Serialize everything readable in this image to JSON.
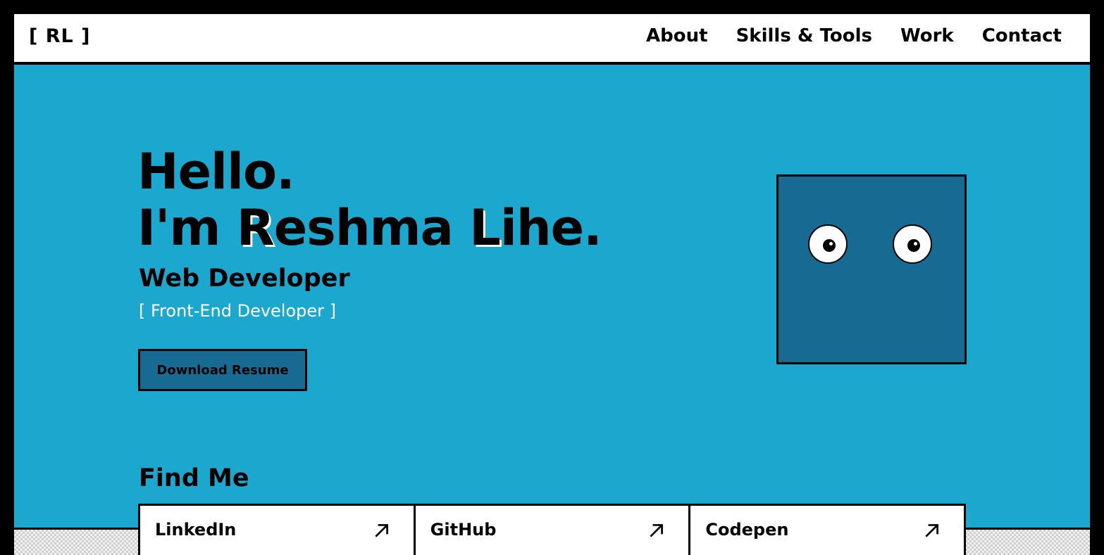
{
  "header": {
    "logo": "[ RL ]",
    "nav": [
      "About",
      "Skills & Tools",
      "Work",
      "Contact"
    ]
  },
  "hero": {
    "greeting": "Hello.",
    "intro_prefix": "I'm ",
    "name_first_initial": "R",
    "name_first_rest": "eshma ",
    "name_last_initial": "L",
    "name_last_rest": "ihe.",
    "role": "Web Developer",
    "sub_role": "[ Front-End Developer ]",
    "resume_button": "Download Resume"
  },
  "find_me": {
    "title": "Find Me",
    "links": [
      {
        "label": "LinkedIn",
        "icon": "arrow-up-right-icon"
      },
      {
        "label": "GitHub",
        "icon": "arrow-up-right-icon"
      },
      {
        "label": "Codepen",
        "icon": "arrow-up-right-icon"
      }
    ]
  },
  "colors": {
    "background": "#1ba7ce",
    "accent_dark": "#176b92",
    "frame": "#000000",
    "header_bg": "#ffffff"
  }
}
